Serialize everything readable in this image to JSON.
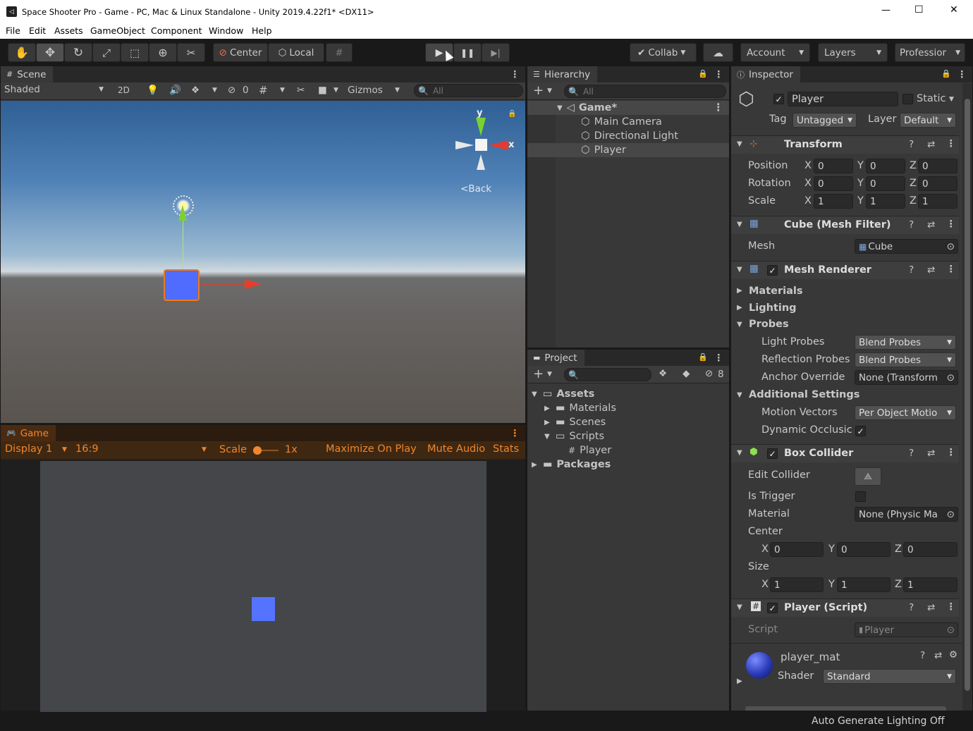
{
  "window": {
    "title": "Space Shooter Pro - Game - PC, Mac & Linux Standalone - Unity 2019.4.22f1* <DX11>",
    "minimize": "—",
    "maximize": "☐",
    "close": "✕"
  },
  "menu": [
    "File",
    "Edit",
    "Assets",
    "GameObject",
    "Component",
    "Window",
    "Help"
  ],
  "toolbar": {
    "center": "Center",
    "local": "Local",
    "collab": "Collab",
    "account": "Account",
    "layers": "Layers",
    "layout": "Professior"
  },
  "scene": {
    "tab": "Scene",
    "shading": "Shaded",
    "mode2d": "2D",
    "hidden_count": "0",
    "gizmos": "Gizmos",
    "search_placeholder": "All",
    "gizmo_y": "y",
    "gizmo_x": "x",
    "view_label": "<Back"
  },
  "game": {
    "tab": "Game",
    "display": "Display 1",
    "aspect": "16:9",
    "scale_label": "Scale",
    "scale_value": "1x",
    "maximize": "Maximize On Play",
    "mute": "Mute Audio",
    "stats": "Stats"
  },
  "hierarchy": {
    "tab": "Hierarchy",
    "search_placeholder": "All",
    "scene_name": "Game*",
    "items": [
      "Main Camera",
      "Directional Light",
      "Player"
    ]
  },
  "project": {
    "tab": "Project",
    "hidden_count": "8",
    "tree": [
      {
        "label": "Assets",
        "level": 0,
        "expanded": true
      },
      {
        "label": "Materials",
        "level": 1
      },
      {
        "label": "Scenes",
        "level": 1
      },
      {
        "label": "Scripts",
        "level": 1,
        "expanded": true
      },
      {
        "label": "Player",
        "level": 2,
        "script": true
      },
      {
        "label": "Packages",
        "level": 0
      }
    ]
  },
  "inspector": {
    "tab": "Inspector",
    "object_name": "Player",
    "static_label": "Static",
    "tag_label": "Tag",
    "tag_value": "Untagged",
    "layer_label": "Layer",
    "layer_value": "Default",
    "transform": {
      "title": "Transform",
      "position_label": "Position",
      "rotation_label": "Rotation",
      "scale_label": "Scale",
      "axis_x": "X",
      "axis_y": "Y",
      "axis_z": "Z",
      "position": [
        "0",
        "0",
        "0"
      ],
      "rotation": [
        "0",
        "0",
        "0"
      ],
      "scale": [
        "1",
        "1",
        "1"
      ]
    },
    "mesh_filter": {
      "title": "Cube (Mesh Filter)",
      "mesh_label": "Mesh",
      "mesh_value": "Cube"
    },
    "mesh_renderer": {
      "title": "Mesh Renderer",
      "materials": "Materials",
      "lighting": "Lighting",
      "probes": "Probes",
      "light_probes_label": "Light Probes",
      "light_probes_value": "Blend Probes",
      "reflection_probes_label": "Reflection Probes",
      "reflection_probes_value": "Blend Probes",
      "anchor_label": "Anchor Override",
      "anchor_value": "None (Transform",
      "additional": "Additional Settings",
      "motion_label": "Motion Vectors",
      "motion_value": "Per Object Motio",
      "dynamic_label": "Dynamic Occlusic"
    },
    "box_collider": {
      "title": "Box Collider",
      "edit_label": "Edit Collider",
      "trigger_label": "Is Trigger",
      "material_label": "Material",
      "material_value": "None (Physic Ma",
      "center_label": "Center",
      "size_label": "Size",
      "center": [
        "0",
        "0",
        "0"
      ],
      "size": [
        "1",
        "1",
        "1"
      ]
    },
    "script": {
      "title": "Player (Script)",
      "script_label": "Script",
      "script_value": "Player"
    },
    "material": {
      "name": "player_mat",
      "shader_label": "Shader",
      "shader_value": "Standard"
    }
  },
  "status": {
    "text": "Auto Generate Lighting Off"
  },
  "colors": {
    "accent_orange": "#f07a17",
    "cube_blue": "#4f6cff",
    "game_bg": "#45464a",
    "unity_dark": "#383838"
  }
}
